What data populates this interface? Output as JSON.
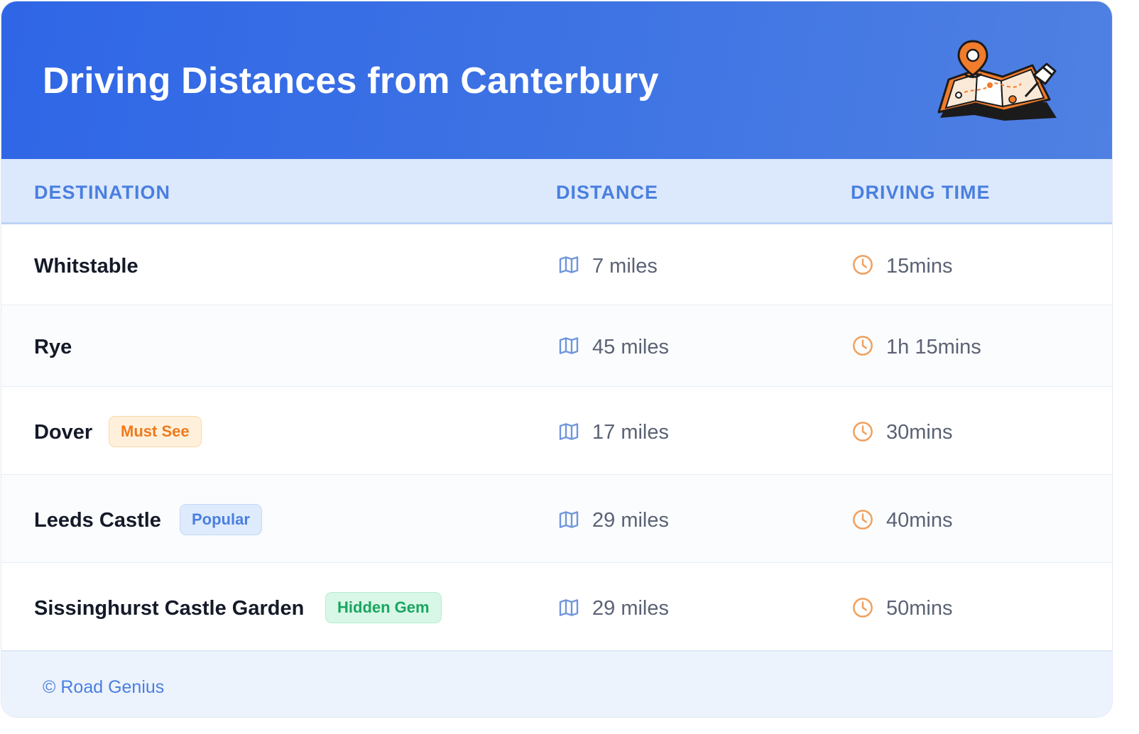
{
  "header": {
    "title": "Driving Distances from Canterbury",
    "illustration": "map-with-location-pin-icon"
  },
  "table": {
    "columns": [
      "DESTINATION",
      "DISTANCE",
      "DRIVING TIME"
    ],
    "rows": [
      {
        "destination": "Whitstable",
        "badge": "",
        "distance": "7 miles",
        "time": "15mins"
      },
      {
        "destination": "Rye",
        "badge": "",
        "distance": "45 miles",
        "time": "1h 15mins"
      },
      {
        "destination": "Dover",
        "badge": "Must See",
        "badge_color": "#ee7a1c",
        "distance": "17 miles",
        "time": "30mins"
      },
      {
        "destination": "Leeds Castle",
        "badge": "Popular",
        "badge_color": "#4a7fe0",
        "distance": "29 miles",
        "time": "40mins"
      },
      {
        "destination": "Sissinghurst Castle Garden",
        "badge": "Hidden Gem",
        "badge_color": "#1aa561",
        "distance": "29 miles",
        "time": "50mins"
      }
    ],
    "distance_icon": "map-icon",
    "time_icon": "clock-icon"
  },
  "footer": {
    "text": "© Road Genius"
  },
  "colors": {
    "header_bg": "#2f66e6",
    "accent": "#4a7fe0",
    "distance_icon": "#6f96dc",
    "time_icon": "#f0a160"
  }
}
